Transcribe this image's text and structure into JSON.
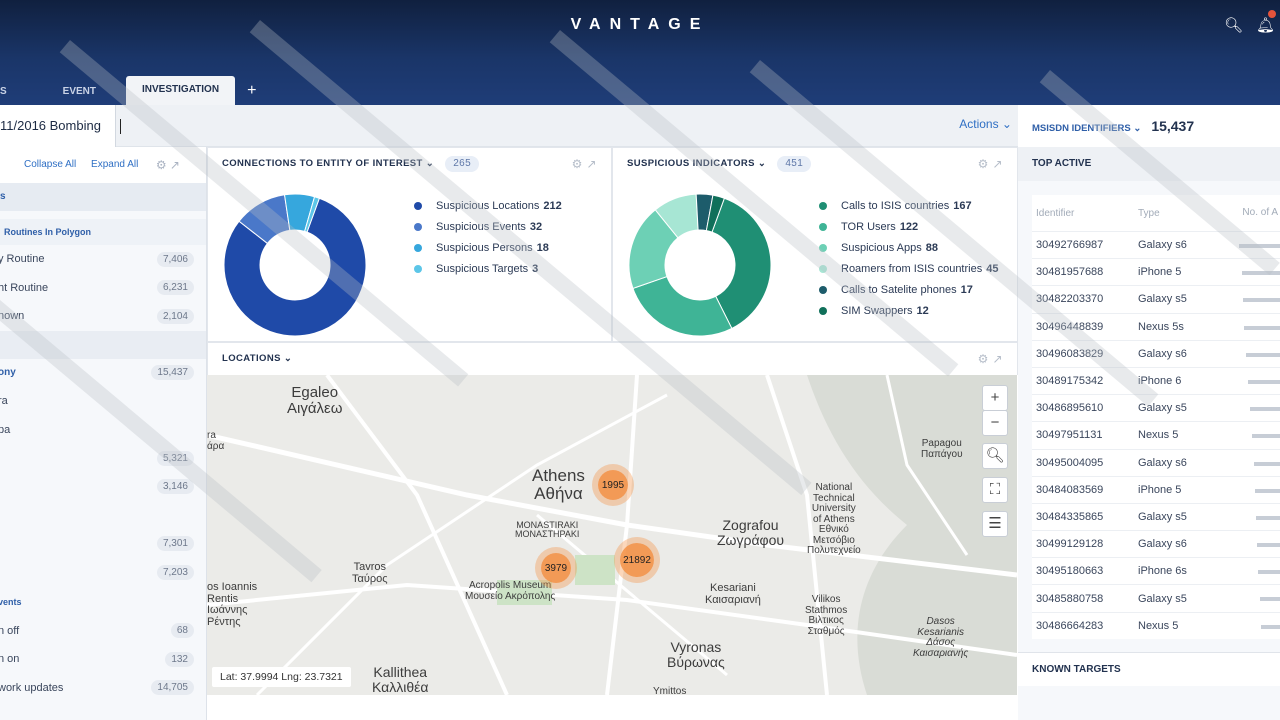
{
  "header": {
    "brand": "VANTAGE",
    "tabs": [
      {
        "label": "S"
      },
      {
        "label": "EVENT"
      },
      {
        "label": "INVESTIGATION"
      }
    ],
    "add_tab": "+"
  },
  "subbar": {
    "investigation_title": "11/2016 Bombing",
    "actions_label": "Actions ⌄"
  },
  "left_panel": {
    "collapse_all": "Collapse All",
    "expand_all": "Expand All",
    "section1_title": "s",
    "subsection_title": "Routines In Polygon",
    "routines": [
      {
        "label": "y Routine",
        "count": "7,406"
      },
      {
        "label": "ht Routine",
        "count": "6,231"
      },
      {
        "label": "nown",
        "count": "2,104"
      }
    ],
    "section2_title": "ony",
    "section2_count": "15,437",
    "items": [
      {
        "label": "ra",
        "count": ""
      },
      {
        "label": "pa",
        "count": ""
      },
      {
        "label": "",
        "count": "5,321"
      },
      {
        "label": "",
        "count": "3,146"
      },
      {
        "label": "",
        "count": ""
      },
      {
        "label": "",
        "count": "7,301"
      },
      {
        "label": "",
        "count": "7,203"
      }
    ],
    "events_title": "vents",
    "events": [
      {
        "label": "n off",
        "count": "68"
      },
      {
        "label": "n on",
        "count": "132"
      },
      {
        "label": "work updates",
        "count": "14,705"
      }
    ]
  },
  "connections": {
    "title": "CONNECTIONS TO ENTITY OF INTEREST ⌄",
    "count": "265",
    "legend": [
      {
        "label": "Suspicious Locations",
        "value": "212",
        "color": "#1f4aa8"
      },
      {
        "label": "Suspicious Events",
        "value": "32",
        "color": "#4a78c9"
      },
      {
        "label": "Suspicious Persons",
        "value": "18",
        "color": "#36a7dd"
      },
      {
        "label": "Suspicious Targets",
        "value": "3",
        "color": "#5cc6e8"
      }
    ]
  },
  "indicators": {
    "title": "SUSPICIOUS INDICATORS ⌄",
    "count": "451",
    "legend": [
      {
        "label": "Calls to ISIS countries",
        "value": "167",
        "color": "#1f8f74"
      },
      {
        "label": "TOR Users",
        "value": "122",
        "color": "#3fb496"
      },
      {
        "label": "Suspicious Apps",
        "value": "88",
        "color": "#6dd0b5"
      },
      {
        "label": "Roamers from ISIS countries",
        "value": "45",
        "color": "#a7e6d4"
      },
      {
        "label": "Calls to Satelite phones",
        "value": "17",
        "color": "#1d5c6b"
      },
      {
        "label": "SIM Swappers",
        "value": "12",
        "color": "#10705a"
      }
    ]
  },
  "locations": {
    "title": "LOCATIONS ⌄",
    "labels": [
      {
        "text": "Egaleo\nΑιγάλεω",
        "size": "big"
      },
      {
        "text": "Athens\nΑθήνα",
        "size": "huge"
      },
      {
        "text": "Zografou\nΖωγράφου",
        "size": "big"
      },
      {
        "text": "Kallithea\nΚαλλιθέα",
        "size": "big"
      },
      {
        "text": "Vyronas\nΒύρωνας",
        "size": "big"
      },
      {
        "text": "Tavros\nΤαύρος",
        "size": "small"
      },
      {
        "text": "Kesariani\nΚαισαριανή",
        "size": "small"
      },
      {
        "text": "MONASTIRAKI\nΜΟΝΑΣΤΗΡΑΚΙ",
        "size": "tiny"
      },
      {
        "text": "Acropolis Museum\nΜουσείο Ακρόπολης",
        "size": "tiny"
      },
      {
        "text": "National\nTechnical\nUniversity\nof Athens\nΕθνικό\nΜετσόβιο\nΠολυτεχνείο",
        "size": "tiny"
      },
      {
        "text": "Papagou\nΠαπάγου",
        "size": "tiny"
      },
      {
        "text": "Vilikos\nStathmos\nΒιλτικος\nΣταθμός",
        "size": "tiny"
      },
      {
        "text": "Dasos\nKesarianis\nΔάσος\nΚαισαριανής",
        "size": "tiny"
      },
      {
        "text": "os Ioannis\nRentis\nΙωάννης\nΡέντης",
        "size": "small"
      },
      {
        "text": "ra\nάρα",
        "size": "tiny"
      },
      {
        "text": "Ymittos",
        "size": "tiny"
      }
    ],
    "clusters": [
      {
        "label": "1995"
      },
      {
        "label": "3979"
      },
      {
        "label": "21892"
      }
    ],
    "coords": "Lat: 37.9994 Lng: 23.7321"
  },
  "right_panel": {
    "title": "MSISDN IDENTIFIERS ⌄",
    "total": "15,437",
    "top_active": "TOP ACTIVE",
    "columns": [
      "Identifier",
      "Type",
      "No. of A"
    ],
    "rows": [
      {
        "id": "30492766987",
        "type": "Galaxy s6",
        "bar": 0.68
      },
      {
        "id": "30481957688",
        "type": "iPhone 5",
        "bar": 0.64
      },
      {
        "id": "30482203370",
        "type": "Galaxy s5",
        "bar": 0.62
      },
      {
        "id": "30496448839",
        "type": "Nexus 5s",
        "bar": 0.6
      },
      {
        "id": "30496083829",
        "type": "Galaxy s6",
        "bar": 0.57
      },
      {
        "id": "30489175342",
        "type": "iPhone 6",
        "bar": 0.53
      },
      {
        "id": "30486895610",
        "type": "Galaxy s5",
        "bar": 0.5
      },
      {
        "id": "30497951131",
        "type": "Nexus 5",
        "bar": 0.46
      },
      {
        "id": "30495004095",
        "type": "Galaxy s6",
        "bar": 0.44
      },
      {
        "id": "30484083569",
        "type": "iPhone 5",
        "bar": 0.42
      },
      {
        "id": "30484335865",
        "type": "Galaxy s5",
        "bar": 0.4
      },
      {
        "id": "30499129128",
        "type": "Galaxy s6",
        "bar": 0.38
      },
      {
        "id": "30495180663",
        "type": "iPhone 6s",
        "bar": 0.36
      },
      {
        "id": "30485880758",
        "type": "Galaxy s5",
        "bar": 0.34
      },
      {
        "id": "30486664283",
        "type": "Nexus 5",
        "bar": 0.32
      }
    ],
    "known_targets": "KNOWN TARGETS"
  }
}
